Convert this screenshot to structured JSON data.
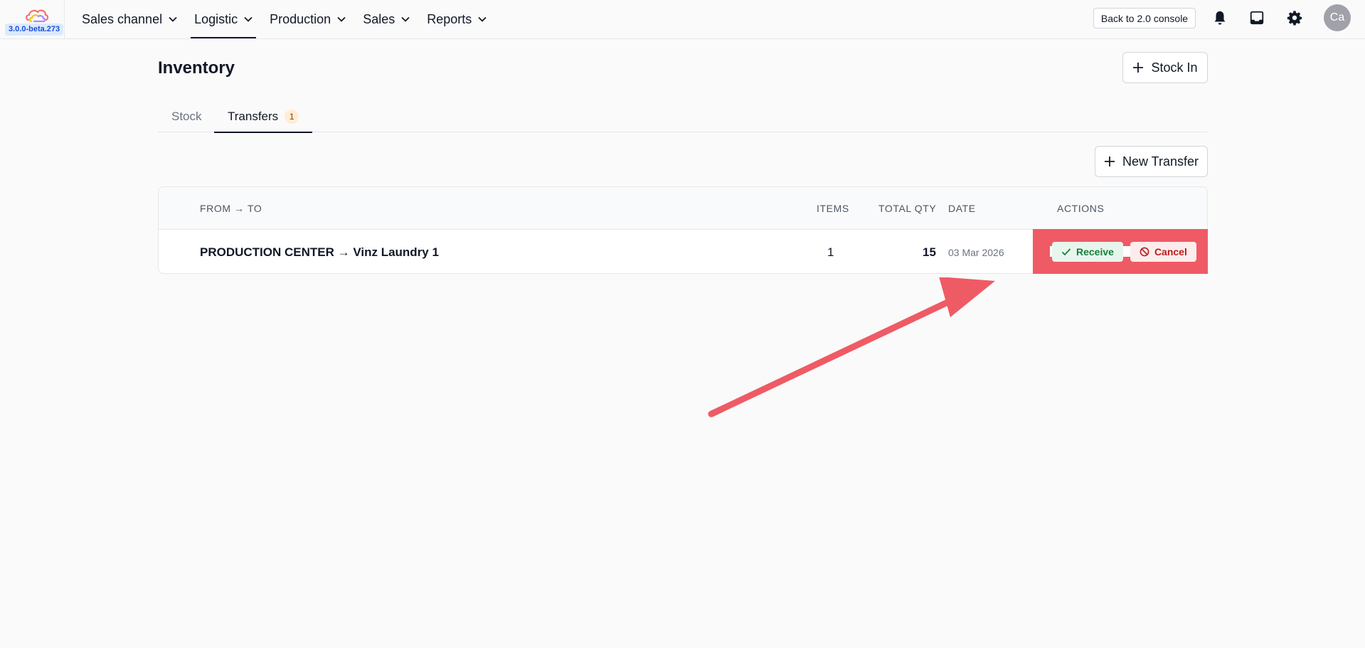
{
  "app": {
    "version": "3.0.0-beta.273",
    "logo_icon": "cloud-logo",
    "nav": [
      {
        "label": "Sales channel",
        "active": false
      },
      {
        "label": "Logistic",
        "active": true
      },
      {
        "label": "Production",
        "active": false
      },
      {
        "label": "Sales",
        "active": false
      },
      {
        "label": "Reports",
        "active": false
      }
    ],
    "console_label": "Back to 2.0 console",
    "icons": [
      "bell-icon",
      "inbox-icon",
      "gear-icon"
    ],
    "avatar_initials": "Ca"
  },
  "page": {
    "title": "Inventory",
    "stock_in_label": "Stock In",
    "new_transfer_label": "New Transfer",
    "tabs": [
      {
        "label": "Stock",
        "active": false
      },
      {
        "label": "Transfers",
        "active": true,
        "count": "1"
      }
    ]
  },
  "table": {
    "headers": {
      "route": "FROM → TO",
      "items": "ITEMS",
      "total_qty": "TOTAL QTY",
      "date": "DATE",
      "actions": "ACTIONS"
    },
    "rows": [
      {
        "route": "PRODUCTION CENTER → Vinz Laundry 1",
        "items": "1",
        "total_qty": "15",
        "date": "03 Mar 2026",
        "receive_label": "Receive",
        "cancel_label": "Cancel"
      }
    ]
  },
  "colors": {
    "annotation": "#ef5b65",
    "receive": "#15803d",
    "cancel": "#b91c1c",
    "badge_bg": "#ffedd5"
  }
}
